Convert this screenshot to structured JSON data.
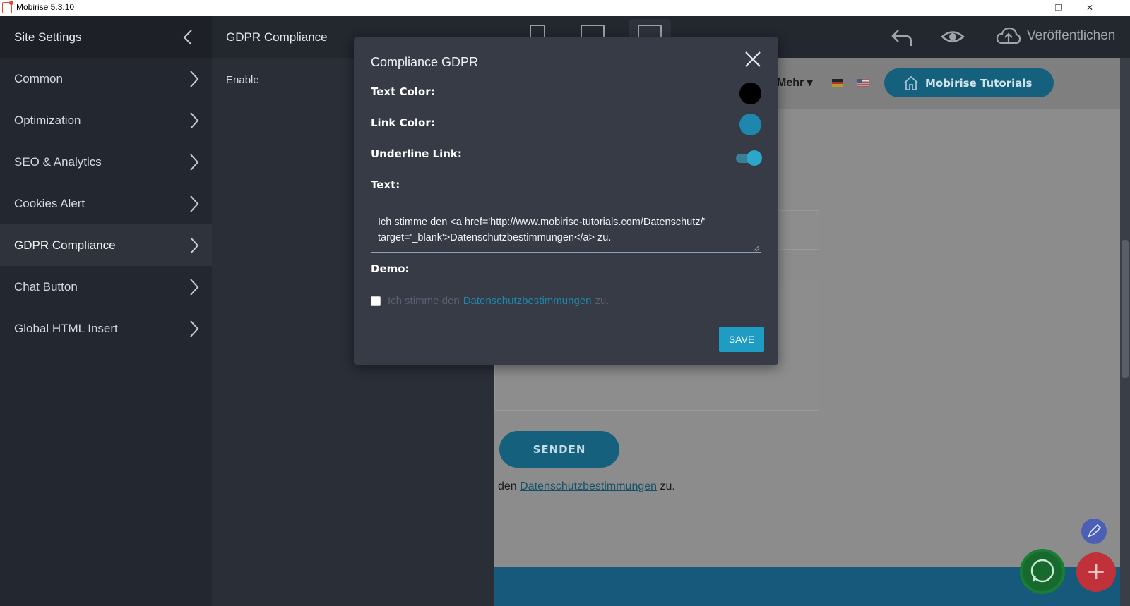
{
  "window": {
    "title": "Mobirise 5.3.10"
  },
  "sidebar": {
    "title": "Site Settings",
    "items": [
      {
        "label": "Common"
      },
      {
        "label": "Optimization"
      },
      {
        "label": "SEO & Analytics"
      },
      {
        "label": "Cookies Alert"
      },
      {
        "label": "GDPR Compliance",
        "active": true
      },
      {
        "label": "Chat Button"
      },
      {
        "label": "Global HTML Insert"
      }
    ]
  },
  "subpanel": {
    "title": "GDPR Compliance",
    "enable_label": "Enable"
  },
  "toolbar": {
    "publish_label": "Veröffentlichen"
  },
  "preview": {
    "menu_more": "Mehr",
    "tutorials_button": "Mobirise Tutorials",
    "submit_button": "SENDEN",
    "consent_prefix": "den",
    "consent_link": "Datenschutzbestimmungen",
    "consent_suffix": "zu."
  },
  "modal": {
    "title": "Compliance GDPR",
    "text_color_label": "Text Color:",
    "text_color": "#000000",
    "link_color_label": "Link Color:",
    "link_color": "#1f86ad",
    "underline_label": "Underline Link:",
    "underline_enabled": true,
    "text_label": "Text:",
    "text_value": "Ich stimme den <a href='http://www.mobirise-tutorials.com/Datenschutz/' target='_blank'>Datenschutzbestimmungen</a> zu.",
    "demo_label": "Demo:",
    "demo_prefix": "Ich stimme den",
    "demo_link": "Datenschutzbestimmungen",
    "demo_suffix": "zu.",
    "save_label": "SAVE"
  },
  "colors": {
    "accent": "#1e9cc4",
    "brand_button": "#14607d",
    "fab_add": "#c0313a",
    "fab_edit": "#4a5fb5",
    "fab_whatsapp": "#166a2d"
  }
}
